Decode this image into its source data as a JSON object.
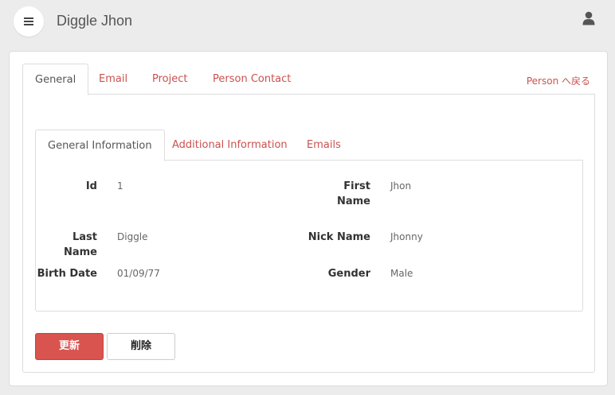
{
  "header": {
    "title": "Diggle Jhon"
  },
  "tabs": [
    {
      "label": "General",
      "active": true
    },
    {
      "label": "Email"
    },
    {
      "label": "Project"
    },
    {
      "label": "Person Contact"
    }
  ],
  "back_link": "Person へ戻る",
  "subtabs": [
    {
      "label": "General Information",
      "active": true
    },
    {
      "label": "Additional Information"
    },
    {
      "label": "Emails"
    }
  ],
  "fields": {
    "id": {
      "label": "Id",
      "value": "1"
    },
    "first_name": {
      "label_line1": "First",
      "label_line2": "Name",
      "value": "Jhon"
    },
    "last_name": {
      "label": "Last Name",
      "value": "Diggle"
    },
    "nick_name": {
      "label": "Nick Name",
      "value": "Jhonny"
    },
    "birth_date": {
      "label": "Birth Date",
      "value": "01/09/77"
    },
    "gender": {
      "label": "Gender",
      "value": "Male"
    }
  },
  "buttons": {
    "update": "更新",
    "delete": "削除"
  },
  "colors": {
    "accent": "#d9534f",
    "link": "#c9524f",
    "background": "#ececec"
  },
  "icons": {
    "menu": "hamburger-icon",
    "user": "user-icon"
  }
}
